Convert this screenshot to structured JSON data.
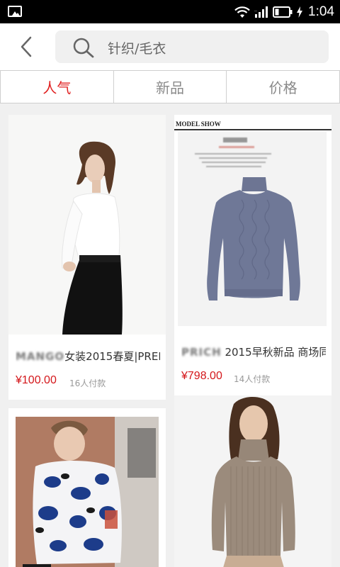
{
  "status_bar": {
    "time": "1:04",
    "icons": [
      "gallery-icon",
      "wifi-icon",
      "signal-icon",
      "battery-icon",
      "charging-icon"
    ]
  },
  "header": {
    "back_icon": "chevron-left-icon",
    "search_icon": "search-icon",
    "search_text": "针织/毛衣"
  },
  "tabs": [
    {
      "label": "人气",
      "active": true
    },
    {
      "label": "新品",
      "active": false
    },
    {
      "label": "价格",
      "active": false
    }
  ],
  "colors": {
    "accent": "#e02020",
    "price": "#d4171b",
    "background": "#f0f0f0"
  },
  "products": [
    {
      "brand_blurred": "MANGO",
      "title": "女装2015春夏|PREI",
      "price": "¥100.00",
      "sold": "16人付款"
    },
    {
      "brand_blurred": "PRICH",
      "title": " 2015早秋新品 商场同",
      "price": "¥798.00",
      "sold": "14人付款",
      "image_header": "MODEL SHOW"
    },
    {},
    {}
  ]
}
